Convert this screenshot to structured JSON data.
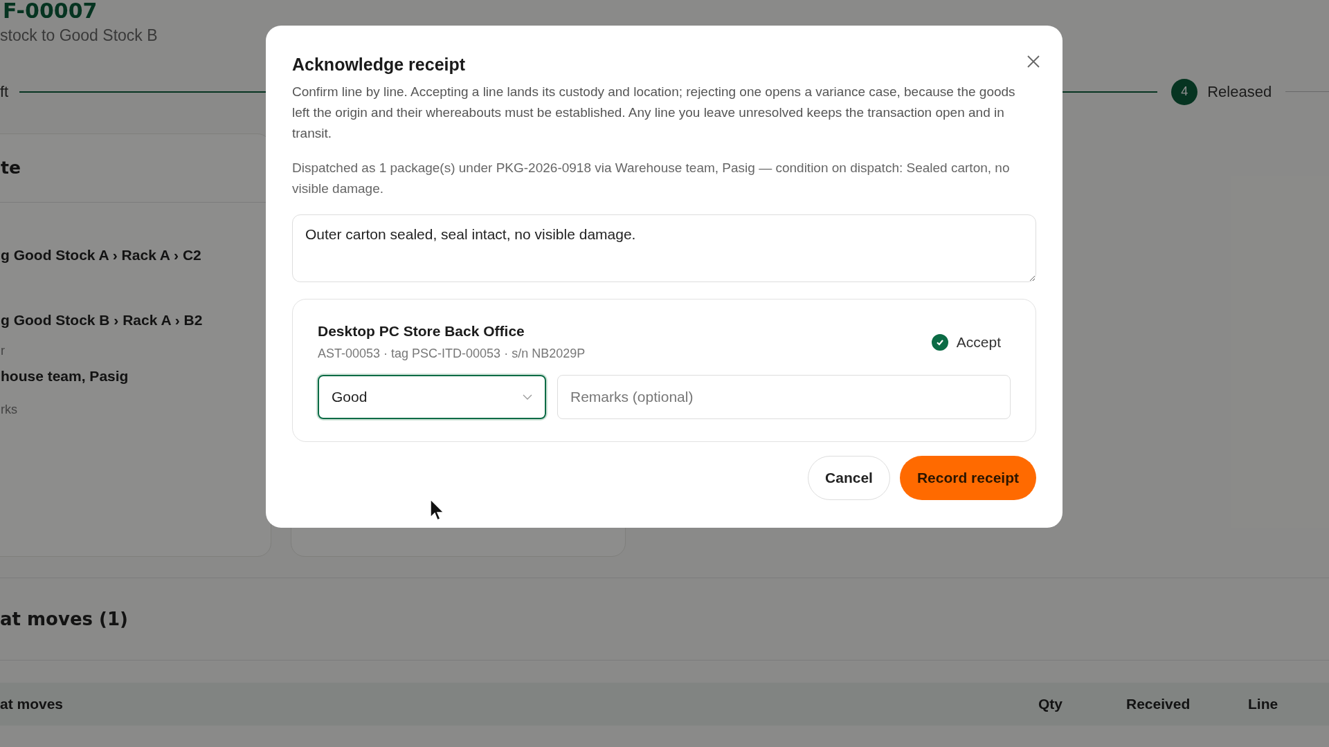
{
  "page": {
    "title": "F-00007",
    "subtitle": "stock to Good Stock B",
    "steps": [
      {
        "label": "ft"
      },
      {
        "number": "4",
        "label": "Released"
      }
    ],
    "card": {
      "heading": "te",
      "fields": [
        {
          "value": "g Good Stock A › Rack A › C2"
        },
        {
          "value": "g Good Stock B › Rack A › B2"
        },
        {
          "label": "r",
          "value": "house team, Pasig"
        },
        {
          "label": "rks"
        }
      ]
    },
    "section_title": "at moves (1)",
    "table": {
      "columns": [
        "at moves",
        "Qty",
        "Received",
        "Line"
      ]
    }
  },
  "dialog": {
    "title": "Acknowledge receipt",
    "paragraphs": [
      "Confirm line by line. Accepting a line lands its custody and location; rejecting one opens a variance case, because the goods left the origin and their whereabouts must be established. Any line you leave unresolved keeps the transaction open and in transit.",
      "Dispatched as 1 package(s) under PKG-2026-0918 via Warehouse team, Pasig — condition on dispatch: Sealed carton, no visible damage."
    ],
    "notes": "Outer carton sealed, seal intact, no visible damage.",
    "line": {
      "name": "Desktop PC Store Back Office",
      "meta": "AST-00053 · tag PSC-ITD-00053 · s/n NB2029P",
      "accept": {
        "label": "Accept",
        "checked": true
      },
      "condition": "Good",
      "remarks_placeholder": "Remarks (optional)"
    },
    "buttons": [
      {
        "label": "Cancel",
        "kind": "secondary"
      },
      {
        "label": "Record receipt",
        "kind": "primary"
      }
    ]
  }
}
